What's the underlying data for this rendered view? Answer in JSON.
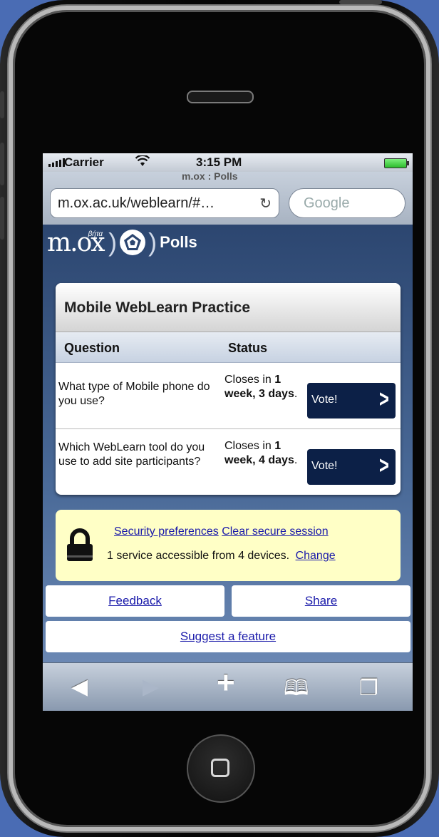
{
  "statusbar": {
    "carrier": "Carrier",
    "time": "3:15 PM"
  },
  "browser": {
    "page_title": "m.ox : Polls",
    "url": "m.ox.ac.uk/weblearn/#…",
    "search_placeholder": "Google"
  },
  "header": {
    "logo_text": "m.ox",
    "logo_beta": "βήτα",
    "title": "Polls"
  },
  "polls": {
    "title": "Mobile WebLearn Practice",
    "col_question": "Question",
    "col_status": "Status",
    "rows": [
      {
        "question": "What type of Mobile phone do you use?",
        "status_prefix": "Closes in ",
        "status_bold": "1 week, 3 days",
        "status_suffix": ".",
        "vote": "Vote!"
      },
      {
        "question": "Which WebLearn tool do you use to add site participants?",
        "status_prefix": "Closes in ",
        "status_bold": "1 week, 4 days",
        "status_suffix": ".",
        "vote": "Vote!"
      }
    ]
  },
  "security": {
    "link_prefs": "Security preferences",
    "link_clear": "Clear secure session",
    "info": "1 service accessible from 4 devices.",
    "link_change": "Change"
  },
  "footer": {
    "feedback": "Feedback",
    "share": "Share",
    "suggest": "Suggest a feature"
  },
  "toolbar": {
    "back": "◀",
    "forward": "▶",
    "add": "+",
    "bookmarks": "🕮",
    "pages": "❐"
  }
}
